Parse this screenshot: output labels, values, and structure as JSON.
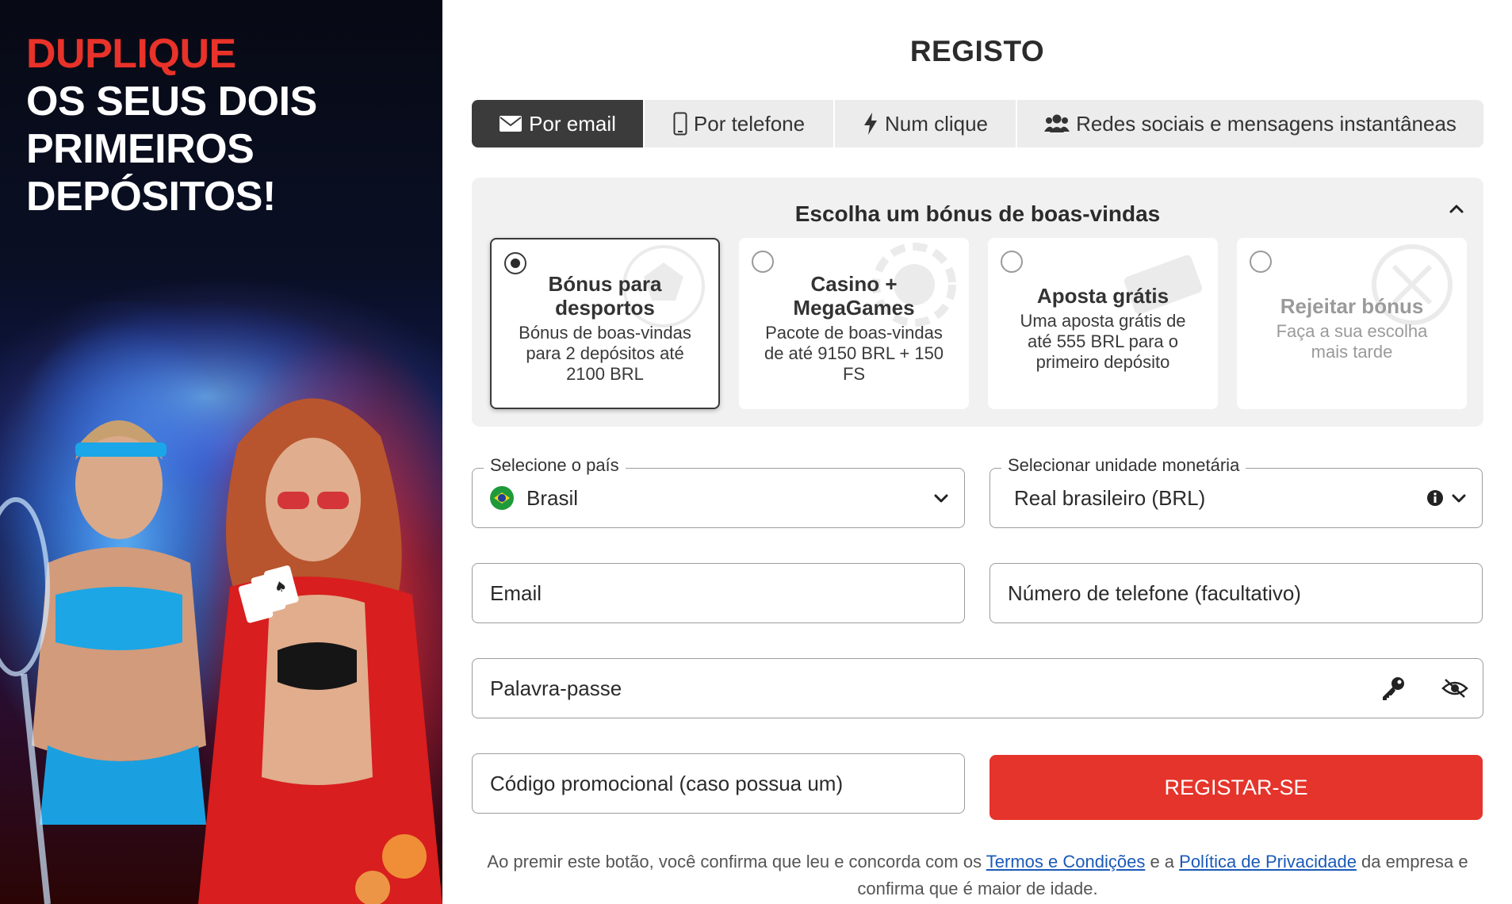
{
  "promo": {
    "line1": "DUPLIQUE",
    "line2": "OS SEUS DOIS",
    "line3": "PRIMEIROS",
    "line4": "DEPÓSITOS!"
  },
  "form": {
    "title": "REGISTO",
    "tabs": [
      {
        "label": "Por email",
        "icon": "envelope-icon",
        "active": true
      },
      {
        "label": "Por telefone",
        "icon": "phone-icon",
        "active": false
      },
      {
        "label": "Num clique",
        "icon": "lightning-icon",
        "active": false
      },
      {
        "label": "Redes sociais e mensagens instantâneas",
        "icon": "users-icon",
        "active": false
      }
    ],
    "bonus": {
      "title": "Escolha um bónus de boas-vindas",
      "options": [
        {
          "title": "Bónus para desportos",
          "desc": "Bónus de boas-vindas para 2 depósitos até 2100 BRL",
          "selected": true
        },
        {
          "title": "Casino + MegaGames",
          "desc": "Pacote de boas-vindas de até 9150 BRL + 150 FS",
          "selected": false
        },
        {
          "title": "Aposta grátis",
          "desc": "Uma aposta grátis de até 555 BRL para o primeiro depósito",
          "selected": false
        },
        {
          "title": "Rejeitar bónus",
          "desc": "Faça a sua escolha mais tarde",
          "selected": false
        }
      ]
    },
    "country": {
      "legend": "Selecione o país",
      "value": "Brasil"
    },
    "currency": {
      "legend": "Selecionar unidade monetária",
      "value": "Real brasileiro (BRL)"
    },
    "email": {
      "placeholder": "Email"
    },
    "phone": {
      "placeholder": "Número de telefone (facultativo)"
    },
    "password": {
      "placeholder": "Palavra-passe"
    },
    "promo_code": {
      "placeholder": "Código promocional (caso possua um)"
    },
    "submit_label": "REGISTAR-SE",
    "legal": {
      "prefix": "Ao premir este botão, você confirma que leu e concorda com os ",
      "terms_link": "Termos e Condições",
      "middle": " e a ",
      "privacy_link": "Política de Privacidade",
      "suffix": " da empresa e confirma que é maior de idade."
    }
  },
  "colors": {
    "accent": "#e5342b",
    "active_tab": "#3b3b3b",
    "link": "#1a5ab8"
  }
}
